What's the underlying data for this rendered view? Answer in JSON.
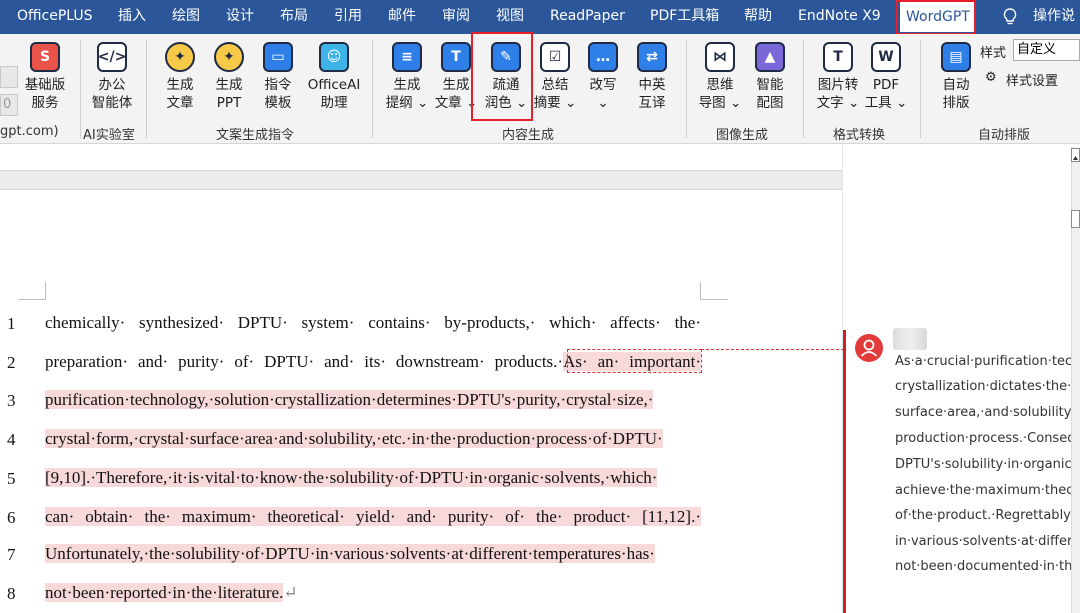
{
  "menu": {
    "tabs": [
      "OfficePLUS",
      "插入",
      "绘图",
      "设计",
      "布局",
      "引用",
      "邮件",
      "审阅",
      "视图",
      "ReadPaper",
      "PDF工具箱",
      "帮助",
      "EndNote X9",
      "WordGPT",
      "操作说"
    ],
    "active_tab": "WordGPT"
  },
  "ribbon": {
    "left_partial_label": "gpt.com)",
    "small_box_text": "0",
    "basic": {
      "l1": "基础版",
      "l2": "服务"
    },
    "office_agent": {
      "l1": "办公",
      "l2": "智能体"
    },
    "group_ai_lab": "AI实验室",
    "gen_article": {
      "l1": "生成",
      "l2": "文章"
    },
    "gen_ppt": {
      "l1": "生成",
      "l2": "PPT"
    },
    "cmd_template": {
      "l1": "指令",
      "l2": "模板"
    },
    "officeai": {
      "l1": "OfficeAI",
      "l2": "助理"
    },
    "group_copy_cmd": "文案生成指令",
    "gen_outline": {
      "l1": "生成",
      "l2": "提纲 ⌄"
    },
    "gen_article2": {
      "l1": "生成",
      "l2": "文章 ⌄"
    },
    "polish": {
      "l1": "疏通",
      "l2": "润色 ⌄"
    },
    "summary": {
      "l1": "总结",
      "l2": "摘要 ⌄"
    },
    "rewrite": {
      "l1": "改写",
      "l2": "⌄"
    },
    "translate": {
      "l1": "中英",
      "l2": "互译"
    },
    "group_content": "内容生成",
    "mindmap": {
      "l1": "思维",
      "l2": "导图 ⌄"
    },
    "smart_image": {
      "l1": "智能",
      "l2": "配图"
    },
    "group_image": "图像生成",
    "img_to_text": {
      "l1": "图片转",
      "l2": "文字 ⌄"
    },
    "pdf_tools": {
      "l1": "PDF",
      "l2": "工具 ⌄"
    },
    "group_format": "格式转换",
    "auto_layout": {
      "l1": "自动",
      "l2": "排版"
    },
    "style_label": "样式",
    "style_value": "自定义",
    "style_settings": "样式设置",
    "group_auto_layout": "自动排版"
  },
  "document": {
    "lines": [
      {
        "n": "1",
        "plain": "chemically· synthesized· DPTU· system· contains· by-products,· which· affects· the·",
        "hl": ""
      },
      {
        "n": "2",
        "plain": "preparation· and· purity· of· DPTU· and· its· downstream· products.·",
        "hl": "As· an· important·"
      },
      {
        "n": "3",
        "plain": "",
        "hl": "purification·technology,·solution·crystallization·determines·DPTU's·purity,·crystal·size,·"
      },
      {
        "n": "4",
        "plain": "",
        "hl": "crystal·form,·crystal·surface·area·and·solubility,·etc.·in·the·production·process·of·DPTU·"
      },
      {
        "n": "5",
        "plain": "",
        "hl": "[9,10].·Therefore,·it·is·vital·to·know·the·solubility·of·DPTU·in·organic·solvents,·which·"
      },
      {
        "n": "6",
        "plain": "",
        "hl": "can· obtain· the· maximum· theoretical· yield· and· purity· of· the· product· [11,12].·"
      },
      {
        "n": "7",
        "plain": "",
        "hl": "Unfortunately,·the·solubility·of·DPTU·in·various·solvents·at·different·temperatures·has·"
      },
      {
        "n": "8",
        "plain": "",
        "hl": "not·been·reported·in·the·literature.",
        "mark": "↵"
      }
    ]
  },
  "comment": {
    "lines": [
      "As·a·crucial·purification·techn",
      "crystallization·dictates·the·pu",
      "surface·area,·and·solubility·of",
      "production·process.·Consequ",
      "DPTU's·solubility·in·organic·s",
      "achieve·the·maximum·theore",
      "of·the·product.·Regrettably,·t",
      "in·various·solvents·at·differen",
      "not·been·documented·in·the·"
    ]
  },
  "colors": {
    "menubar": "#2b579a",
    "highlight": "#f7d9da",
    "redbox": "#e81e2b",
    "comment_bar": "#d0202b"
  }
}
